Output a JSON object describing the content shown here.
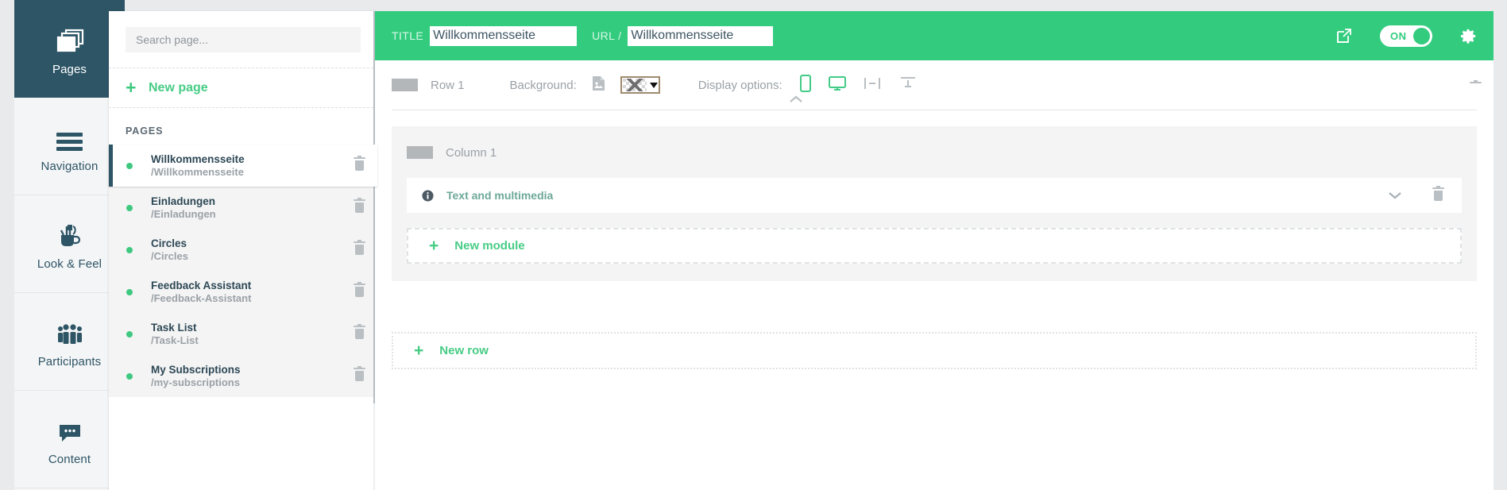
{
  "rail": {
    "items": [
      {
        "label": "Pages",
        "icon": "pages-icon",
        "active": true
      },
      {
        "label": "Navigation",
        "icon": "hamburger-icon",
        "active": false
      },
      {
        "label": "Look & Feel",
        "icon": "mug-pencil-icon",
        "active": false
      },
      {
        "label": "Participants",
        "icon": "people-icon",
        "active": false
      },
      {
        "label": "Content",
        "icon": "speech-bubble-icon",
        "active": false
      }
    ]
  },
  "pages_panel": {
    "search": {
      "placeholder": "Search page...",
      "value": ""
    },
    "new_page_label": "New page",
    "section_header": "PAGES",
    "items": [
      {
        "title": "Willkommensseite",
        "url": "/Willkommensseite",
        "selected": true
      },
      {
        "title": "Einladungen",
        "url": "/Einladungen",
        "selected": false
      },
      {
        "title": "Circles",
        "url": "/Circles",
        "selected": false
      },
      {
        "title": "Feedback Assistant",
        "url": "/Feedback-Assistant",
        "selected": false
      },
      {
        "title": "Task List",
        "url": "/Task-List",
        "selected": false
      },
      {
        "title": "My Subscriptions",
        "url": "/my-subscriptions",
        "selected": false
      }
    ]
  },
  "editor": {
    "header": {
      "title_label": "TITLE",
      "title_value": "Willkommensseite",
      "url_label": "URL /",
      "url_value": "Willkommensseite",
      "preview_icon": "external-link-icon",
      "toggle_label": "ON",
      "toggle_state": "on",
      "settings_icon": "gear-icon",
      "background_color": "#33cc7f"
    },
    "row_toolbar": {
      "drag_handle": "drag-handle",
      "row_name": "Row 1",
      "background_label": "Background:",
      "background_image_icon": "image-icon",
      "background_color_value": "none",
      "display_options_label": "Display options:",
      "display_icons": [
        {
          "name": "mobile-icon",
          "active": true
        },
        {
          "name": "desktop-icon",
          "active": true
        },
        {
          "name": "full-width-icon",
          "active": false
        },
        {
          "name": "padding-icon",
          "active": false
        }
      ],
      "collapse_icon": "chevron-up-icon",
      "delete_icon": "trash-icon"
    },
    "row_body": {
      "column_name": "Column 1",
      "module": {
        "icon": "info-icon",
        "name": "Text and multimedia",
        "expand_icon": "chevron-down-icon",
        "delete_icon": "trash-icon"
      },
      "new_module_label": "New module"
    },
    "new_row_label": "New row"
  },
  "colors": {
    "accent_green": "#33cc7f",
    "link_green": "#47cc85",
    "dark_teal": "#2d5566",
    "muted_grey": "#9aa1a7",
    "module_teal": "#6da89a"
  }
}
